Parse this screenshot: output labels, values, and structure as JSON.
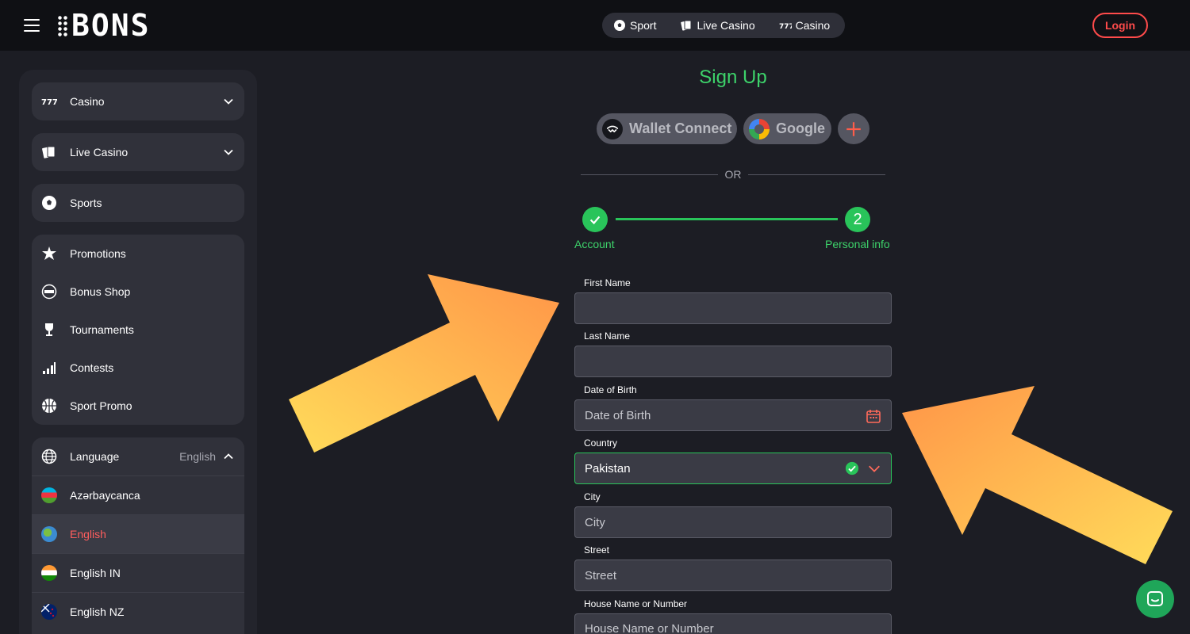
{
  "header": {
    "logo_text": "BONS",
    "nav": [
      {
        "label": "Sport",
        "icon": "soccer-ball-icon"
      },
      {
        "label": "Live Casino",
        "icon": "cards-icon"
      },
      {
        "label": "Casino",
        "icon": "slot-777-icon"
      }
    ],
    "login_label": "Login"
  },
  "sidebar": {
    "casino": "Casino",
    "live_casino": "Live Casino",
    "sports": "Sports",
    "promotions": "Promotions",
    "bonus_shop": "Bonus Shop",
    "tournaments": "Tournaments",
    "contests": "Contests",
    "sport_promo": "Sport Promo",
    "language_label": "Language",
    "language_value": "English",
    "languages": [
      "Azərbaycanca",
      "English",
      "English IN",
      "English NZ"
    ]
  },
  "signup": {
    "title": "Sign Up",
    "wallet_connect": "Wallet Connect",
    "google": "Google",
    "or": "OR",
    "step1_label": "Account",
    "step2_number": "2",
    "step2_label": "Personal info",
    "first_name_label": "First Name",
    "first_name_value": "",
    "last_name_label": "Last Name",
    "last_name_value": "",
    "dob_label": "Date of Birth",
    "dob_placeholder": "Date of Birth",
    "country_label": "Country",
    "country_value": "Pakistan",
    "city_label": "City",
    "city_placeholder": "City",
    "street_label": "Street",
    "street_placeholder": "Street",
    "house_label": "House Name or Number",
    "house_placeholder": "House Name or Number"
  },
  "colors": {
    "accent_green": "#29c45a",
    "login_red": "#ff4b4b",
    "arrow_orange": "#ff9a48",
    "arrow_yellow": "#ffd95a"
  }
}
